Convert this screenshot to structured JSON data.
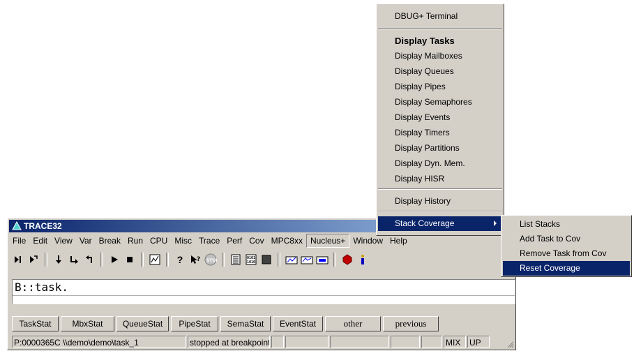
{
  "window": {
    "title": "TRACE32"
  },
  "menubar": [
    "File",
    "Edit",
    "View",
    "Var",
    "Break",
    "Run",
    "CPU",
    "Misc",
    "Trace",
    "Perf",
    "Cov",
    "MPC8xx",
    "Nucleus+",
    "Window",
    "Help"
  ],
  "toolbar": {
    "icons": [
      "step-into",
      "step-over",
      "go-down",
      "go-return",
      "go-up",
      "run",
      "stop",
      "view-icon",
      "help-icon",
      "help-context",
      "break-stop",
      "list-icon",
      "dump-icon",
      "register-icon",
      "perf-1",
      "perf-2",
      "perf-3",
      "about-icon",
      "info-icon"
    ]
  },
  "command": {
    "text": "B::task."
  },
  "softkeys": [
    "TaskStat",
    "MbxStat",
    "QueueStat",
    "PipeStat",
    "SemaStat",
    "EventStat",
    "other",
    "previous"
  ],
  "status": {
    "address": "P:0000365C",
    "path": "\\\\demo\\demo\\task_1",
    "state": "stopped at breakpoint",
    "mode": "MIX",
    "updown": "UP"
  },
  "nucleus_menu": {
    "items": [
      "DBUG+ Terminal",
      "Display Tasks",
      "Display Mailboxes",
      "Display Queues",
      "Display Pipes",
      "Display Semaphores",
      "Display Events",
      "Display Timers",
      "Display Partitions",
      "Display Dyn. Mem.",
      "Display HISR",
      "Display History",
      "Stack Coverage"
    ]
  },
  "stack_coverage_menu": {
    "items": [
      "List Stacks",
      "Add Task to Cov",
      "Remove Task from Cov",
      "Reset Coverage"
    ]
  },
  "colors": {
    "highlight": "#0a246a",
    "face": "#d4d0c8"
  }
}
